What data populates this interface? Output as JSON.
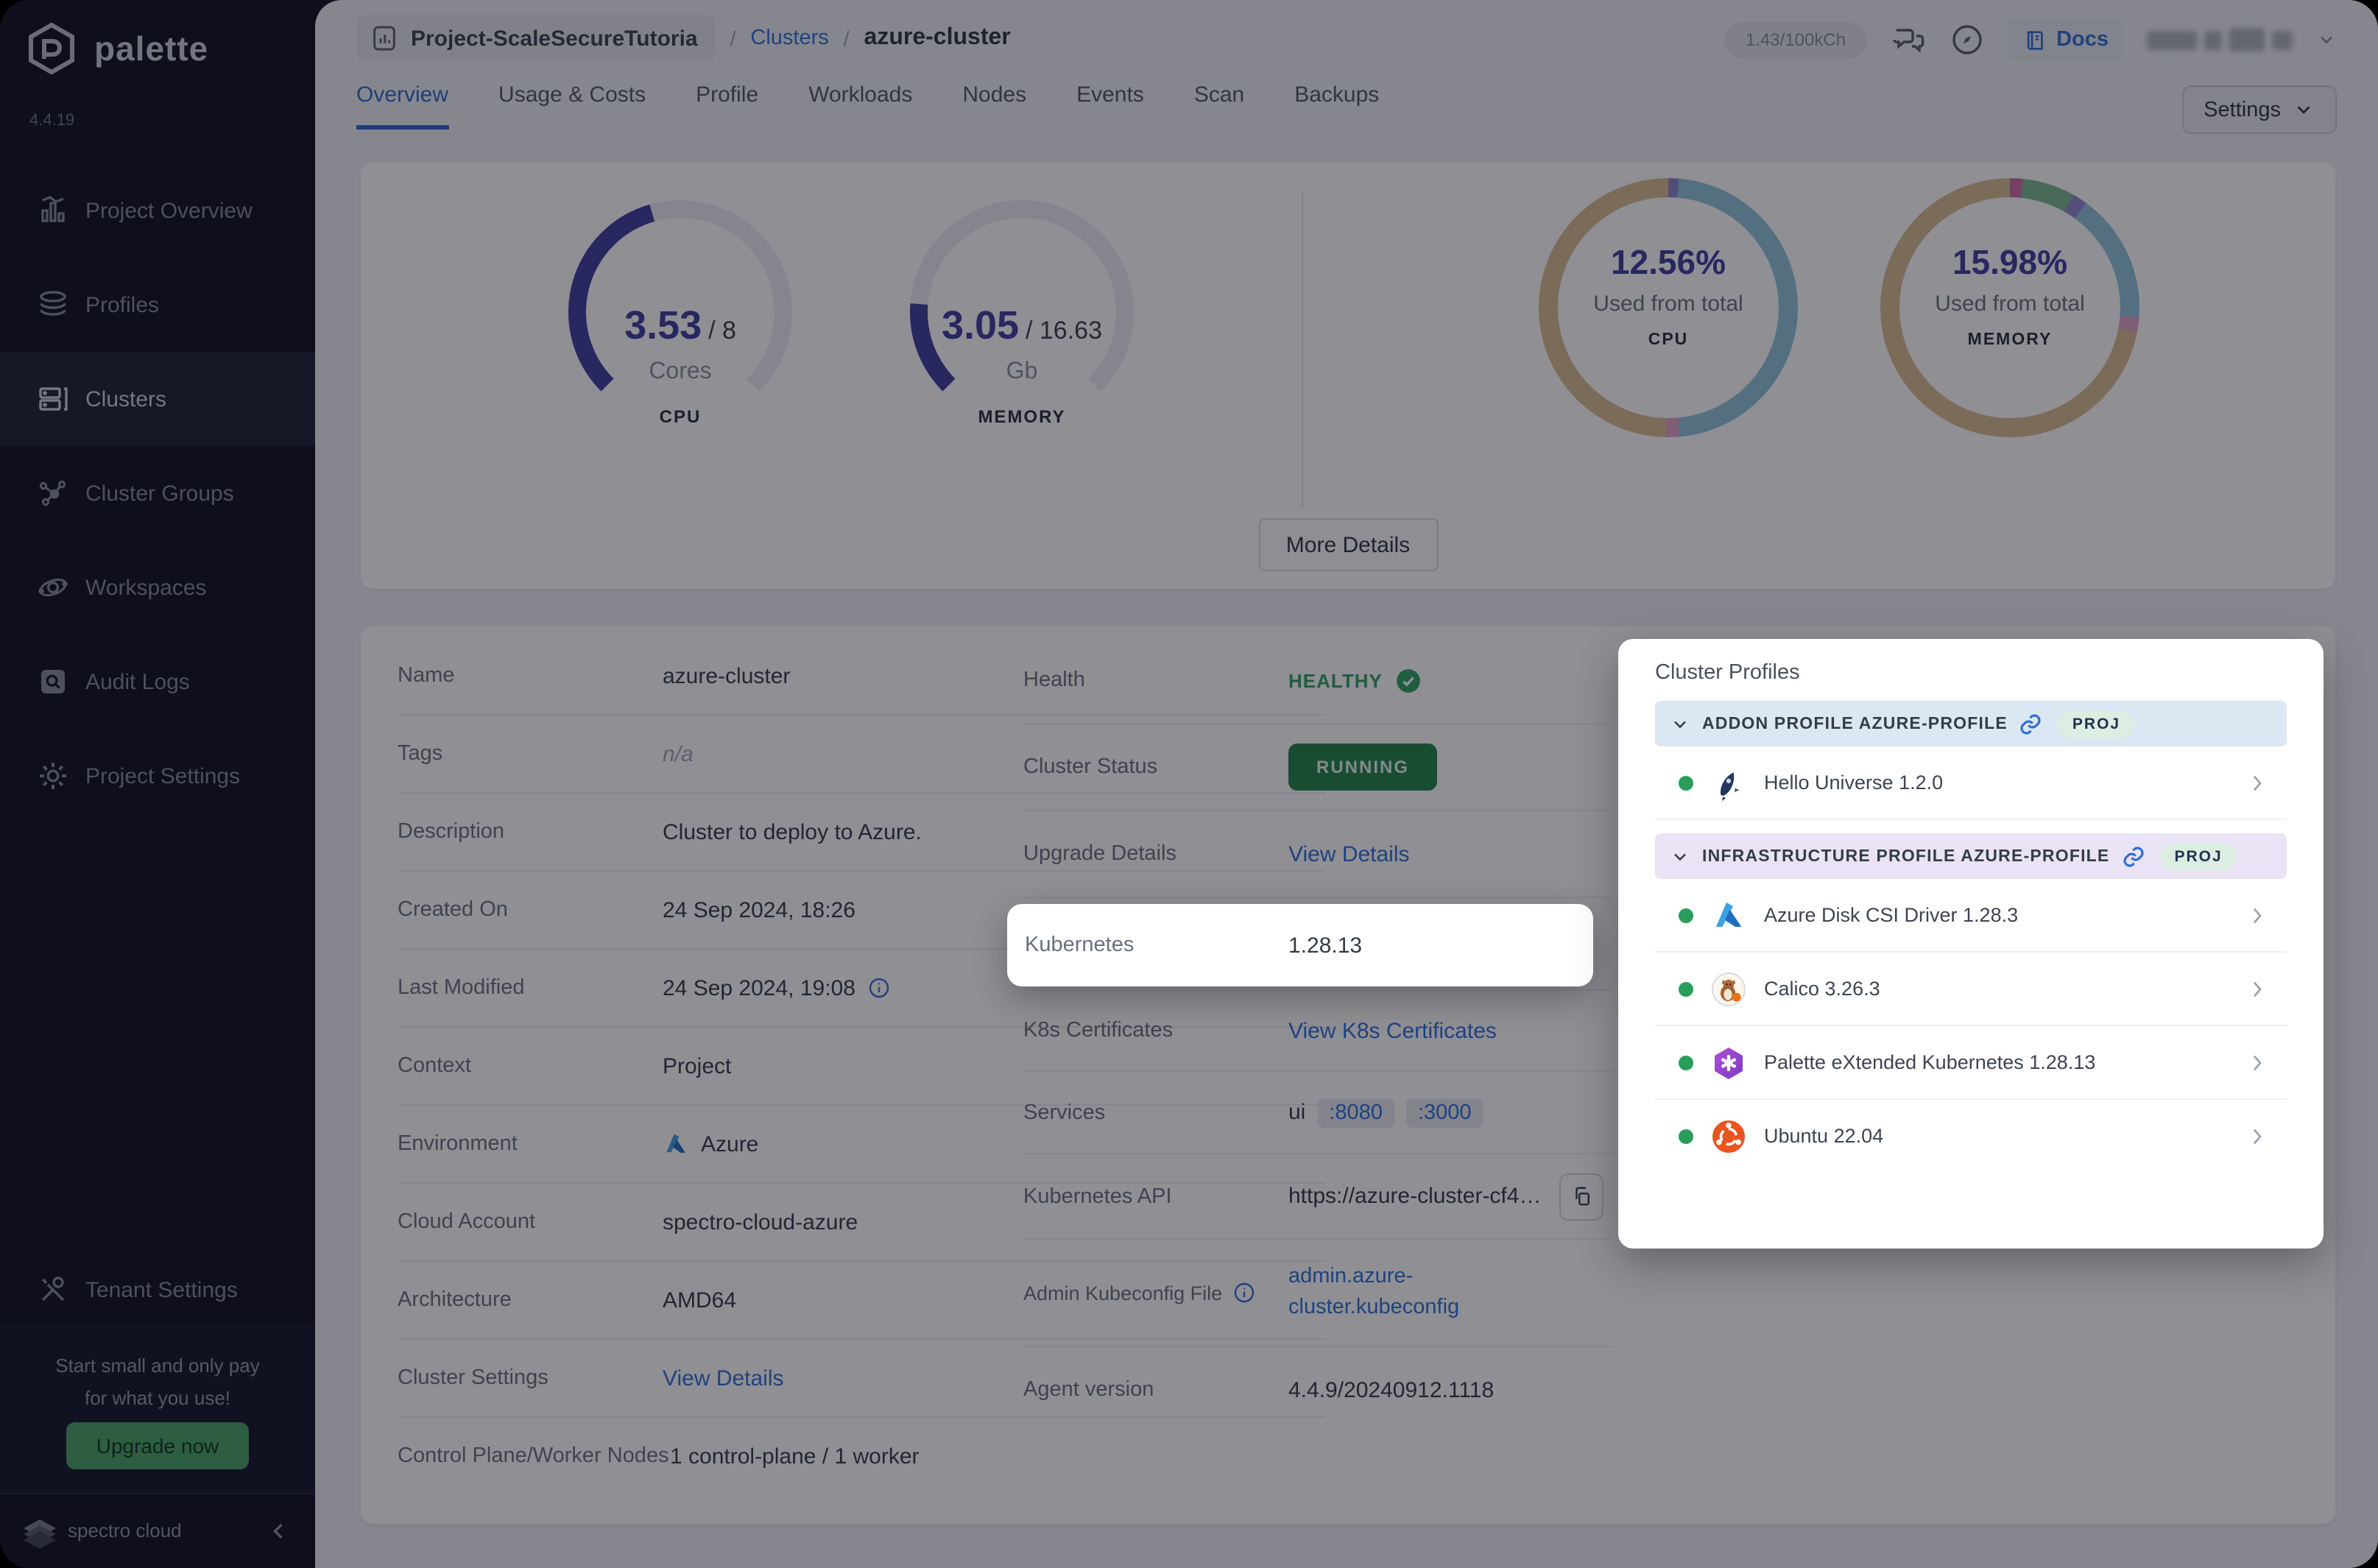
{
  "app": {
    "brand": "palette",
    "version": "4.4.19",
    "footer_brand": "spectro cloud"
  },
  "sidebar": {
    "items": [
      {
        "label": "Project Overview"
      },
      {
        "label": "Profiles"
      },
      {
        "label": "Clusters"
      },
      {
        "label": "Cluster Groups"
      },
      {
        "label": "Workspaces"
      },
      {
        "label": "Audit Logs"
      },
      {
        "label": "Project Settings"
      }
    ],
    "tenant": "Tenant Settings",
    "promo_line1": "Start small and only pay",
    "promo_line2": "for what you use!",
    "upgrade": "Upgrade now"
  },
  "header": {
    "project": "Project-ScaleSecureTutoria",
    "sep1": "/",
    "sep2": "/",
    "crumb_link": "Clusters",
    "crumb_current": "azure-cluster",
    "usage": "1.43/100kCh",
    "docs": "Docs"
  },
  "tabs": {
    "labels": [
      "Overview",
      "Usage & Costs",
      "Profile",
      "Workloads",
      "Nodes",
      "Events",
      "Scan",
      "Backups"
    ],
    "settings": "Settings"
  },
  "overview": {
    "cpu_gauge": {
      "value": "3.53",
      "total": "/ 8",
      "unit": "Cores",
      "label": "CPU"
    },
    "mem_gauge": {
      "value": "3.05",
      "total": "/ 16.63",
      "unit": "Gb",
      "label": "MEMORY"
    },
    "cpu_donut": {
      "pct": "12.56%",
      "caption": "Used from total",
      "label": "CPU"
    },
    "mem_donut": {
      "pct": "15.98%",
      "caption": "Used from total",
      "label": "MEMORY"
    },
    "more_details": "More Details"
  },
  "chart_data": [
    {
      "type": "gauge",
      "title": "CPU",
      "value": 3.53,
      "max": 8,
      "unit": "Cores"
    },
    {
      "type": "gauge",
      "title": "MEMORY",
      "value": 3.05,
      "max": 16.63,
      "unit": "Gb"
    },
    {
      "type": "donut",
      "title": "CPU",
      "value_pct": 12.56,
      "caption": "Used from total"
    },
    {
      "type": "donut",
      "title": "MEMORY",
      "value_pct": 15.98,
      "caption": "Used from total"
    }
  ],
  "details": {
    "left": [
      {
        "label": "Name",
        "value": "azure-cluster"
      },
      {
        "label": "Tags",
        "value": "n/a"
      },
      {
        "label": "Description",
        "value": "Cluster to deploy to Azure."
      },
      {
        "label": "Created On",
        "value": "24 Sep 2024, 18:26"
      },
      {
        "label": "Last Modified",
        "value": "24 Sep 2024, 19:08"
      },
      {
        "label": "Context",
        "value": "Project"
      },
      {
        "label": "Environment",
        "value": "Azure"
      },
      {
        "label": "Cloud Account",
        "value": "spectro-cloud-azure"
      },
      {
        "label": "Architecture",
        "value": "AMD64"
      },
      {
        "label": "Cluster Settings",
        "value": "View Details"
      },
      {
        "label": "Control Plane/Worker Nodes",
        "value": "1 control-plane / 1 worker"
      }
    ],
    "right": {
      "health_label": "Health",
      "health_value": "HEALTHY",
      "status_label": "Cluster Status",
      "status_value": "RUNNING",
      "upgrade_label": "Upgrade Details",
      "upgrade_value": "View Details",
      "k8s_label": "Kubernetes",
      "k8s_value": "1.28.13",
      "certs_label": "K8s Certificates",
      "certs_value": "View K8s Certificates",
      "services_label": "Services",
      "services_prefix": "ui",
      "services_ports": [
        ":8080",
        ":3000"
      ],
      "api_label": "Kubernetes API",
      "api_value": "https://azure-cluster-cf42...",
      "kubeconfig_label": "Admin Kubeconfig File",
      "kubeconfig_line1": "admin.azure-",
      "kubeconfig_line2": "cluster.kubeconfig",
      "agent_label": "Agent version",
      "agent_value": "4.4.9/20240912.1118"
    }
  },
  "profiles": {
    "title": "Cluster Profiles",
    "sections": [
      {
        "header": "ADDON PROFILE AZURE-PROFILE",
        "badge": "PROJ",
        "items": [
          {
            "name": "Hello Universe 1.2.0"
          }
        ]
      },
      {
        "header": "INFRASTRUCTURE PROFILE AZURE-PROFILE",
        "badge": "PROJ",
        "items": [
          {
            "name": "Azure Disk CSI Driver 1.28.3"
          },
          {
            "name": "Calico 3.26.3"
          },
          {
            "name": "Palette eXtended Kubernetes 1.28.13"
          },
          {
            "name": "Ubuntu 22.04"
          }
        ]
      }
    ]
  },
  "colors": {
    "accent_blue": "#2f6fd6",
    "indigo": "#3f3b9e",
    "running_green": "#1f8347",
    "healthy_green": "#2ca05f",
    "upgrade_green": "#47a263",
    "sidebar_bg": "#0c0d1f"
  }
}
